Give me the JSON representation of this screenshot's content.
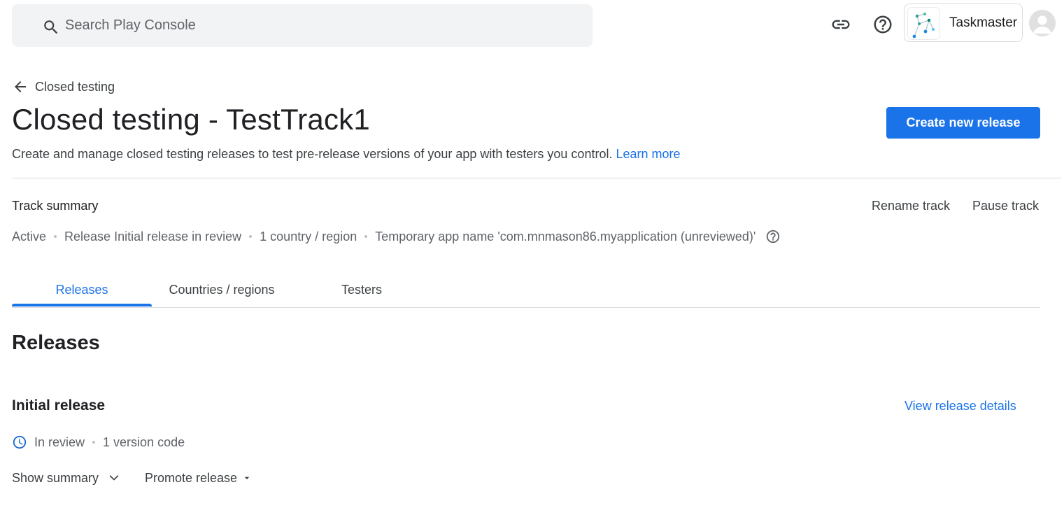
{
  "topbar": {
    "search_placeholder": "Search Play Console",
    "icons": [
      "search-icon",
      "link-icon",
      "help-icon"
    ],
    "app_name": "Taskmaster"
  },
  "header": {
    "back_label": "Closed testing",
    "title": "Closed testing - TestTrack1",
    "create_button": "Create new release",
    "description": "Create and manage closed testing releases to test pre-release versions of your app with testers you control.",
    "learn_more": "Learn more"
  },
  "track_summary": {
    "label": "Track summary",
    "rename": "Rename track",
    "pause": "Pause track",
    "meta": [
      "Active",
      "Release Initial release in review",
      "1 country / region",
      "Temporary app name 'com.mnmason86.myapplication (unreviewed)'"
    ]
  },
  "tabs": [
    {
      "label": "Releases",
      "active": true
    },
    {
      "label": "Countries / regions",
      "active": false
    },
    {
      "label": "Testers",
      "active": false
    }
  ],
  "releases": {
    "heading": "Releases",
    "release_name": "Initial release",
    "view_details": "View release details",
    "status": "In review",
    "version_codes": "1 version code",
    "show_summary": "Show summary",
    "promote": "Promote release"
  },
  "colors": {
    "accent": "#1a73e8",
    "status_icon": "#1967d2"
  }
}
